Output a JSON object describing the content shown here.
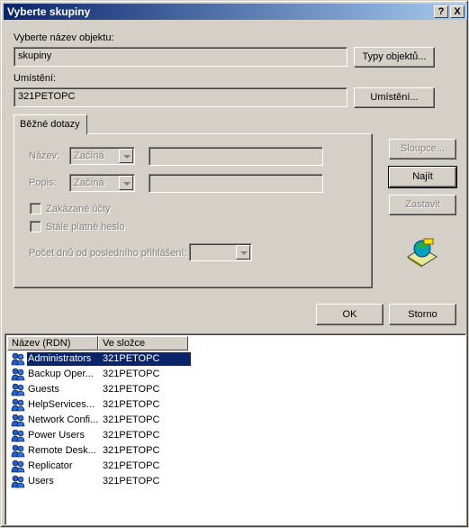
{
  "window": {
    "title": "Vyberte skupiny",
    "help_glyph": "?",
    "close_glyph": "X"
  },
  "object_type": {
    "label": "Vyberte název objektu:",
    "value": "skupiny",
    "button": "Typy objektů..."
  },
  "location": {
    "label": "Umístění:",
    "value": "321PETOPC",
    "button": "Umístění..."
  },
  "tab": {
    "label": "Běžné dotazy"
  },
  "query": {
    "name_label": "Název:",
    "name_op": "Začíná",
    "name_value": "",
    "desc_label": "Popis:",
    "desc_op": "Začíná",
    "desc_value": "",
    "disabled_accounts": "Zakázané účty",
    "non_expiring_password": "Stále platné heslo",
    "days_since_login": "Počet dnů od posledního přihlášení:",
    "days_value": ""
  },
  "side_buttons": {
    "columns": "Sloupce...",
    "find": "Najít",
    "stop": "Zastavit"
  },
  "dialog_buttons": {
    "ok": "OK",
    "cancel": "Storno"
  },
  "results": {
    "columns": [
      "Název (RDN)",
      "Ve složce"
    ],
    "rows": [
      {
        "name": "Administrators",
        "folder": "321PETOPC",
        "selected": true
      },
      {
        "name": "Backup Oper...",
        "folder": "321PETOPC"
      },
      {
        "name": "Guests",
        "folder": "321PETOPC"
      },
      {
        "name": "HelpServices...",
        "folder": "321PETOPC"
      },
      {
        "name": "Network Confi...",
        "folder": "321PETOPC"
      },
      {
        "name": "Power Users",
        "folder": "321PETOPC"
      },
      {
        "name": "Remote Desk...",
        "folder": "321PETOPC"
      },
      {
        "name": "Replicator",
        "folder": "321PETOPC"
      },
      {
        "name": "Users",
        "folder": "321PETOPC"
      }
    ]
  },
  "icons": {
    "search_graphic": "search-globe-icon",
    "group": "user-group-icon"
  }
}
